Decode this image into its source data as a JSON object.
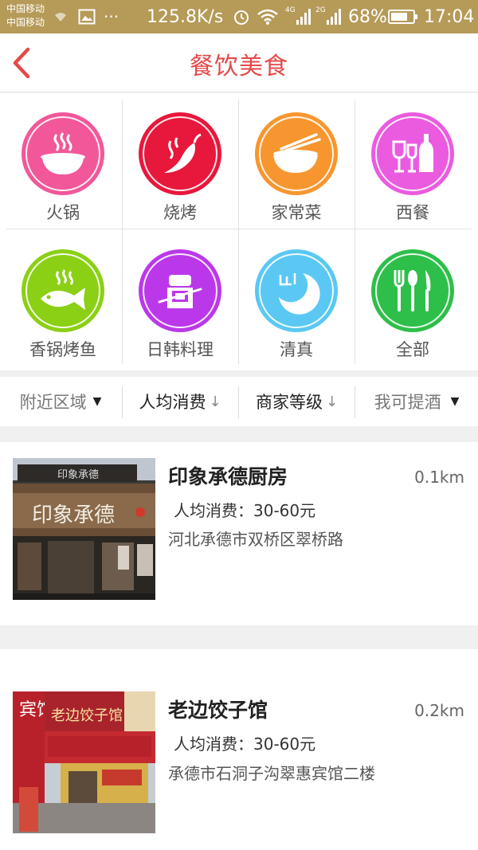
{
  "status_bar": {
    "carrier1": "中国移动",
    "carrier2": "中国移动",
    "net_speed": "125.8K/s",
    "battery": "68%",
    "time": "17:04",
    "sig1": "4G",
    "sig2": "2G"
  },
  "header": {
    "title": "餐饮美食"
  },
  "categories": [
    {
      "label": "火锅",
      "icon": "hotpot-icon",
      "color": "#f2579a"
    },
    {
      "label": "烧烤",
      "icon": "chili-icon",
      "color": "#e8173c"
    },
    {
      "label": "家常菜",
      "icon": "bowl-chopsticks-icon",
      "color": "#f7962f"
    },
    {
      "label": "西餐",
      "icon": "wine-icon",
      "color": "#ea5be0"
    },
    {
      "label": "香锅烤鱼",
      "icon": "fish-icon",
      "color": "#8bd014"
    },
    {
      "label": "日韩料理",
      "icon": "sushi-icon",
      "color": "#bb38ea"
    },
    {
      "label": "清真",
      "icon": "crescent-icon",
      "color": "#5bc8f3"
    },
    {
      "label": "全部",
      "icon": "cutlery-icon",
      "color": "#2ebf4a"
    }
  ],
  "filters": [
    {
      "label": "附近区域",
      "arrow": "▼"
    },
    {
      "label": "人均消费",
      "arrow": "↓"
    },
    {
      "label": "商家等级",
      "arrow": "↓"
    },
    {
      "label": "我可提酒",
      "arrow": "▼"
    }
  ],
  "restaurants": [
    {
      "name": "印象承德厨房",
      "distance": "0.1km",
      "price": "人均消费：30-60元",
      "address": "河北承德市双桥区翠桥路",
      "sign": "印象承德",
      "sign_top": "印象承德"
    },
    {
      "name": "老边饺子馆",
      "distance": "0.2km",
      "price": "人均消费：30-60元",
      "address": "承德市石洞子沟翠惠宾馆二楼",
      "sign": "老边饺子馆",
      "sign_side": "宾馆"
    }
  ]
}
